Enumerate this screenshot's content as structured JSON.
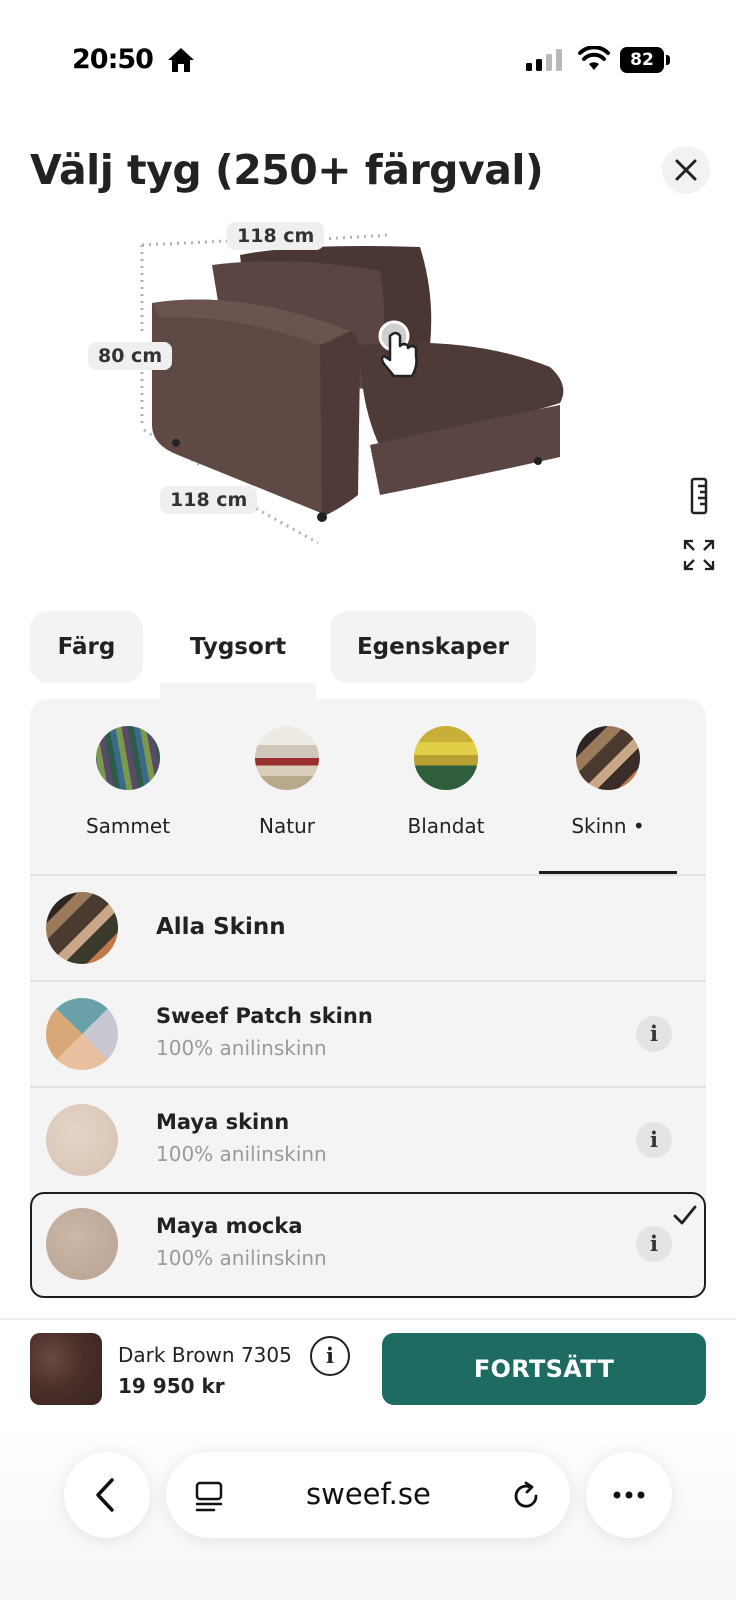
{
  "status_bar": {
    "time": "20:50",
    "battery": "82"
  },
  "header": {
    "title": "Välj tyg (250+ färgval)"
  },
  "product": {
    "dimensions": {
      "width": "118 cm",
      "height": "80 cm",
      "depth": "118 cm"
    }
  },
  "tabs": [
    {
      "label": "Färg",
      "active": false
    },
    {
      "label": "Tygsort",
      "active": true
    },
    {
      "label": "Egenskaper",
      "active": false
    }
  ],
  "categories": [
    {
      "label": "Sammet",
      "selected": false
    },
    {
      "label": "Natur",
      "selected": false
    },
    {
      "label": "Blandat",
      "selected": false
    },
    {
      "label": "Skinn •",
      "selected": true
    }
  ],
  "fabric_list": {
    "all_label": "Alla Skinn",
    "items": [
      {
        "name": "Sweef Patch skinn",
        "description": "100% anilinskinn",
        "selected": false
      },
      {
        "name": "Maya skinn",
        "description": "100% anilinskinn",
        "selected": false
      },
      {
        "name": "Maya mocka",
        "description": "100% anilinskinn",
        "selected": true
      }
    ]
  },
  "summary": {
    "fabric_name": "Dark Brown 7305",
    "price": "19 950 kr",
    "cta_label": "FORTSÄTT",
    "info_glyph": "i"
  },
  "browser": {
    "url": "sweef.se"
  },
  "colors": {
    "accent": "#1e6b62",
    "panel": "#f4f4f4",
    "sofa": "#5a4542"
  },
  "icons": [
    "home-icon",
    "signal-icon",
    "wifi-icon",
    "close-icon",
    "hand-pointer-icon",
    "ruler-icon",
    "expand-icon",
    "info-icon",
    "check-icon",
    "back-icon",
    "tabs-icon",
    "reload-icon",
    "more-icon"
  ]
}
